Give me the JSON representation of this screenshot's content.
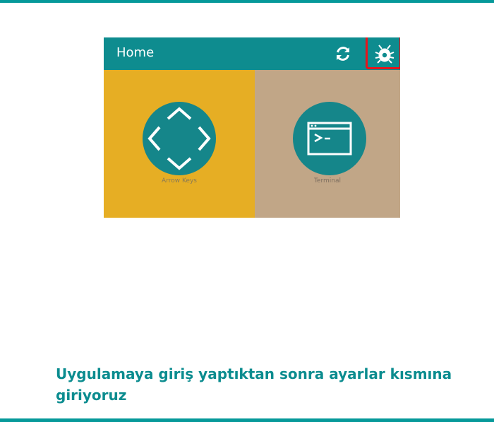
{
  "appbar": {
    "title": "Home",
    "refresh_icon": "refresh-icon",
    "settings_icon": "settings-bug-icon"
  },
  "tiles": [
    {
      "label": "Arrow Keys",
      "icon": "arrow-keys-icon",
      "color": "#e6ae24"
    },
    {
      "label": "Terminal",
      "icon": "terminal-icon",
      "color": "#c1a687"
    }
  ],
  "colors": {
    "accent": "#06999a",
    "appbar": "#0e8c8f",
    "highlight": "#e8131b"
  },
  "caption": "Uygulamaya giriş yaptıktan sonra ayarlar kısmına giriyoruz"
}
